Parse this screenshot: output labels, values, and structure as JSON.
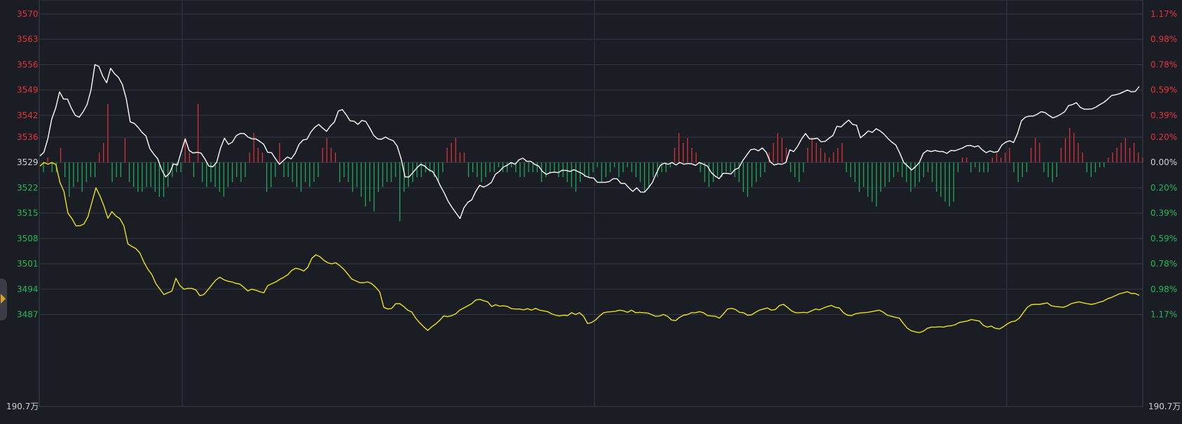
{
  "chart_data": {
    "type": "line",
    "base_price": 3529,
    "ylim": [
      3480,
      3572
    ],
    "left_ticks": [
      3570,
      3563,
      3556,
      3549,
      3542,
      3536,
      3529,
      3522,
      3515,
      3508,
      3501,
      3494,
      3487
    ],
    "right_ticks": [
      "1.17%",
      "0.98%",
      "0.78%",
      "0.59%",
      "0.39%",
      "0.20%",
      "0.00%",
      "0.20%",
      "0.39%",
      "0.59%",
      "0.78%",
      "0.98%",
      "1.17%"
    ],
    "volume_label": "190.7万",
    "series": [
      {
        "color": "#ffffff",
        "values": [
          3530.8,
          3531.8,
          3535.5,
          3541,
          3544,
          3548.5,
          3546.5,
          3546.5,
          3544,
          3542,
          3541.5,
          3543,
          3545,
          3549,
          3556,
          3555.5,
          3552.8,
          3551,
          3555,
          3553.5,
          3552.5,
          3550.5,
          3546.5,
          3540.2,
          3539.8,
          3538.7,
          3537.3,
          3536.3,
          3532.8,
          3531.3,
          3530,
          3527,
          3525,
          3526,
          3528.6,
          3528.3,
          3532,
          3535.5,
          3532.3,
          3531.6,
          3531.8,
          3531.6,
          3530,
          3528,
          3527.8,
          3529,
          3533,
          3535.7,
          3534,
          3534.6,
          3536.4,
          3537,
          3537,
          3536,
          3535.5,
          3535.5,
          3534.8,
          3534,
          3531.8,
          3531.7,
          3530,
          3528.5,
          3529.5,
          3530.5,
          3530,
          3531.5,
          3534,
          3535.2,
          3535.4,
          3537.4,
          3538.7,
          3539.5,
          3538.5,
          3537.6,
          3539.1,
          3540.2,
          3543.2,
          3543.6,
          3542.2,
          3540.5,
          3540.4,
          3539.5,
          3540.6,
          3540.3,
          3538.5,
          3536.5,
          3535.5,
          3535.4,
          3536,
          3535.4,
          3535,
          3533.5,
          3530,
          3525,
          3525,
          3526.2,
          3527.5,
          3528.5,
          3528,
          3527,
          3526.5,
          3524.8,
          3522.5,
          3520.5,
          3518.2,
          3516.5,
          3515,
          3513.5,
          3516.5,
          3518,
          3518.7,
          3521,
          3522.7,
          3522.2,
          3522.7,
          3523.5,
          3525.7,
          3526.5,
          3527.7,
          3528.2,
          3529,
          3528.5,
          3529.7,
          3530.2,
          3529.3,
          3529.3,
          3528.5,
          3528,
          3526.5,
          3525.7,
          3526.2,
          3526.3,
          3526.2,
          3526.8,
          3526.8,
          3526.5,
          3527,
          3526.5,
          3526,
          3525.2,
          3524.8,
          3524.7,
          3523.5,
          3523.5,
          3523.5,
          3523.7,
          3524.5,
          3524.5,
          3523.2,
          3523.2,
          3522,
          3521,
          3522,
          3520.8,
          3520.8,
          3522,
          3523.5,
          3526,
          3528.2,
          3528.8,
          3528.5,
          3529,
          3528.3,
          3529,
          3528.5,
          3528.7,
          3528.6,
          3528.2,
          3529,
          3528.5,
          3528,
          3526.2,
          3525.2,
          3524.5,
          3526,
          3526,
          3525.8,
          3527,
          3527.5,
          3529.5,
          3531,
          3532.5,
          3532.7,
          3532.2,
          3533,
          3531.8,
          3529.2,
          3528.3,
          3528.6,
          3528.5,
          3529,
          3532.5,
          3532,
          3533.5,
          3535.5,
          3537,
          3535.5,
          3535.5,
          3535.7,
          3534.7,
          3534.8,
          3535.7,
          3536.5,
          3539,
          3538.8,
          3539.8,
          3540.7,
          3539.5,
          3539.3,
          3535.8,
          3536.7,
          3537.7,
          3537.3,
          3538.3,
          3537.7,
          3536.8,
          3535.6,
          3534.6,
          3533.8,
          3531.6,
          3529,
          3528,
          3526.9,
          3527.8,
          3529,
          3531.5,
          3532.3,
          3532,
          3532.3,
          3532,
          3532,
          3531.5,
          3532.3,
          3532.2,
          3532.6,
          3533,
          3533.6,
          3533.7,
          3533.3,
          3533.6,
          3532.5,
          3531.7,
          3532.2,
          3531.8,
          3532,
          3533.8,
          3534.6,
          3535,
          3534.5,
          3537,
          3540.5,
          3541.5,
          3541.8,
          3541.8,
          3542.3,
          3543,
          3542.8,
          3542,
          3541.3,
          3541.7,
          3542.3,
          3543,
          3544.7,
          3545,
          3545.5,
          3544.2,
          3543.7,
          3543.7,
          3543.8,
          3544.3,
          3545,
          3545.6,
          3546.5,
          3547.5,
          3547.7,
          3548,
          3548.5,
          3549,
          3548.5,
          3548.6,
          3550
        ]
      },
      {
        "color": "#e8e020",
        "values": [
          3528,
          3529,
          3528.5,
          3529,
          3528.4,
          3523.5,
          3521,
          3515,
          3513.5,
          3511.5,
          3511.5,
          3512,
          3514,
          3518,
          3522,
          3519.8,
          3517,
          3513.6,
          3515.4,
          3514.2,
          3513.5,
          3511.5,
          3506.5,
          3505.8,
          3505.2,
          3504,
          3501.5,
          3499.5,
          3498,
          3495.5,
          3494,
          3492.5,
          3493,
          3493.5,
          3497,
          3495,
          3494,
          3494.2,
          3494.2,
          3493.8,
          3492.2,
          3492.5,
          3493.8,
          3495.2,
          3496.5,
          3497.3,
          3496.6,
          3496.2,
          3496,
          3495.6,
          3495.4,
          3494.5,
          3493.5,
          3494,
          3493.7,
          3493.3,
          3493,
          3495,
          3495.5,
          3496,
          3496.7,
          3497.3,
          3498,
          3499.2,
          3499.8,
          3499.5,
          3499,
          3500,
          3502.5,
          3503.5,
          3503,
          3502,
          3501.3,
          3501,
          3501.3,
          3500.5,
          3499.5,
          3498.2,
          3496.8,
          3496.3,
          3495.8,
          3495.8,
          3496,
          3495.5,
          3494.5,
          3493.2,
          3489,
          3488.5,
          3488.7,
          3490,
          3490,
          3489.2,
          3488.2,
          3487.7,
          3486,
          3484.7,
          3483.6,
          3482.6,
          3483.6,
          3484.4,
          3485.4,
          3486.6,
          3486.4,
          3486.7,
          3487.2,
          3488.2,
          3488.8,
          3489.4,
          3490,
          3491,
          3491.2,
          3490.8,
          3490.5,
          3489.2,
          3489.7,
          3489.3,
          3489.4,
          3489.2,
          3488.6,
          3488.5,
          3488.5,
          3488.3,
          3488.6,
          3488.2,
          3488.7,
          3488.2,
          3488,
          3487.8,
          3487.2,
          3486.8,
          3486.6,
          3486.8,
          3486.7,
          3487.5,
          3487,
          3487.5,
          3486.5,
          3484.5,
          3484.8,
          3485.5,
          3486.6,
          3487.5,
          3487.7,
          3487.8,
          3487.9,
          3488.2,
          3488,
          3487.6,
          3488.2,
          3487.5,
          3487.6,
          3487.5,
          3487.4,
          3487,
          3486.5,
          3486.6,
          3487,
          3486.5,
          3485.5,
          3485.3,
          3486.2,
          3486.8,
          3487,
          3487.5,
          3487.5,
          3487.8,
          3487.5,
          3486.7,
          3486.6,
          3486.5,
          3486,
          3487.2,
          3488.5,
          3488.7,
          3488.4,
          3487.6,
          3487.5,
          3486.8,
          3486.9,
          3487.6,
          3488.2,
          3488.5,
          3488.8,
          3488.2,
          3488.4,
          3489.5,
          3489.8,
          3489,
          3488,
          3487.5,
          3487.5,
          3487.6,
          3487.5,
          3488,
          3488.5,
          3488.3,
          3488.8,
          3489.2,
          3489.5,
          3489,
          3488.8,
          3487.5,
          3486.8,
          3486.7,
          3487.2,
          3487.4,
          3487.5,
          3487.6,
          3487.8,
          3488,
          3488.2,
          3487.6,
          3486.8,
          3486.5,
          3486.2,
          3486,
          3484.5,
          3483.2,
          3482.5,
          3482.2,
          3482,
          3482.4,
          3483.2,
          3483.5,
          3483.5,
          3483.6,
          3483.5,
          3483.8,
          3483.9,
          3484.2,
          3484.8,
          3485,
          3485.2,
          3485.6,
          3485.4,
          3485.2,
          3484,
          3483.5,
          3483.8,
          3483.2,
          3483,
          3483.6,
          3484.4,
          3485,
          3485.2,
          3486,
          3487.5,
          3489,
          3489.7,
          3489.8,
          3489.8,
          3490,
          3490.2,
          3489.4,
          3489.2,
          3489.1,
          3489,
          3489.4,
          3490,
          3490.3,
          3490.5,
          3490.2,
          3490,
          3489.8,
          3490,
          3490.4,
          3490.7,
          3491.3,
          3491.7,
          3492.2,
          3492.7,
          3493,
          3493.3,
          3492.8,
          3492.8,
          3492.3
        ]
      }
    ],
    "volume_bars": [
      -2,
      1,
      -2,
      -2,
      3,
      -3,
      -7,
      -5,
      -4,
      -6,
      -4,
      -3,
      -3,
      2,
      4,
      12,
      -4,
      -3,
      -3,
      5,
      -4,
      -5,
      -6,
      -6,
      -5,
      -5,
      -6,
      -7,
      -7,
      -5,
      -3,
      -2,
      -2,
      5,
      2,
      -3,
      12,
      -4,
      -5,
      -4,
      -5,
      -6,
      -7,
      -5,
      -4,
      -3,
      -4,
      -3,
      2,
      6,
      3,
      2,
      -6,
      -5,
      -3,
      4,
      -3,
      -3,
      -4,
      -5,
      -6,
      -4,
      -5,
      -4,
      -3,
      3,
      5,
      3,
      2,
      -4,
      -3,
      -4,
      -6,
      -5,
      -7,
      -9,
      -8,
      -10,
      -6,
      -5,
      -4,
      -4,
      -3,
      -12,
      -6,
      -5,
      -4,
      -3,
      -3,
      -2,
      -2,
      -3,
      -4,
      -2,
      3,
      4,
      5,
      2,
      2,
      -3,
      -2,
      -3,
      -4,
      -3,
      -2,
      -2,
      -1,
      -2,
      -2,
      -1,
      -2,
      -3,
      -3,
      -2,
      -2,
      -2,
      -4,
      -3,
      -2,
      -2,
      -3,
      -3,
      -4,
      -5,
      -6,
      -4,
      -3,
      -3,
      -2,
      -1,
      -4,
      -3,
      -2,
      -1,
      -3,
      -2,
      -1,
      -2,
      -3,
      -4,
      -6,
      -5,
      -3,
      -3,
      -2,
      -2,
      -1,
      3,
      6,
      4,
      5,
      3,
      2,
      -2,
      -4,
      -5,
      -4,
      -3,
      -3,
      -2,
      -2,
      -3,
      -4,
      -6,
      -7,
      -5,
      -4,
      -3,
      -2,
      2,
      4,
      6,
      5,
      3,
      -2,
      -3,
      -4,
      -2,
      3,
      5,
      4,
      3,
      2,
      1,
      2,
      3,
      4,
      -2,
      -3,
      -4,
      -6,
      -5,
      -7,
      -8,
      -9,
      -6,
      -5,
      -4,
      -3,
      -2,
      -3,
      -4,
      -6,
      -5,
      -4,
      -3,
      -2,
      -4,
      -6,
      -7,
      -8,
      -9,
      -8,
      -2,
      1,
      1,
      -2,
      -1,
      -2,
      -2,
      -2,
      1,
      2,
      1,
      2,
      3,
      -2,
      -4,
      -3,
      -2,
      3,
      5,
      4,
      -2,
      -3,
      -4,
      -3,
      3,
      5,
      7,
      6,
      4,
      2,
      -2,
      -3,
      -2,
      -1,
      -1,
      1,
      2,
      3,
      4,
      5,
      3,
      4,
      2,
      1
    ]
  }
}
